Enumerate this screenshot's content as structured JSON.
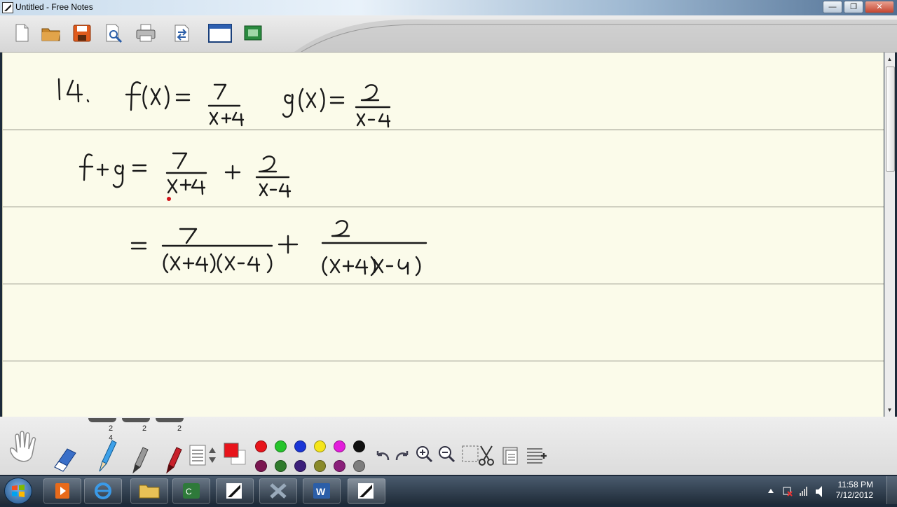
{
  "window": {
    "title": "Untitled - Free Notes",
    "minimize_label": "—",
    "maximize_label": "❐",
    "close_label": "✕"
  },
  "toolbar": {
    "icons": [
      "new-document-icon",
      "open-folder-icon",
      "save-icon",
      "print-preview-icon",
      "print-icon",
      "export-icon",
      "window-icon",
      "screen-capture-icon"
    ]
  },
  "page": {
    "handwritten_lines": [
      "14.  f(x) = 7/(x+4)    g(x) = 2/(x-4)",
      "f+g = 7/(x+4) + 2/(x-4)",
      "= 7/((x+4)(x-4)) + 2/((x+4)(x-4))"
    ]
  },
  "pens": {
    "widths": [
      "2",
      "2",
      "2"
    ],
    "active_index_label": "4"
  },
  "colors": {
    "row1": [
      "#e8141b",
      "#25c42b",
      "#1a35d6",
      "#f5e51a",
      "#e31ddb",
      "#111111"
    ],
    "row2": [
      "#7a1650",
      "#2f7a2c",
      "#3c1f7a",
      "#8a8a2a",
      "#8a1f7a",
      "#7d7d7d"
    ]
  },
  "taskbar": {
    "apps": [
      "explorer-window-icon",
      "media-center-icon",
      "internet-explorer-icon",
      "file-explorer-icon",
      "camtasia-icon",
      "free-notes-icon",
      "network-tool-icon",
      "word-icon",
      "free-notes-active-icon"
    ],
    "time": "11:58 PM",
    "date": "7/12/2012"
  }
}
